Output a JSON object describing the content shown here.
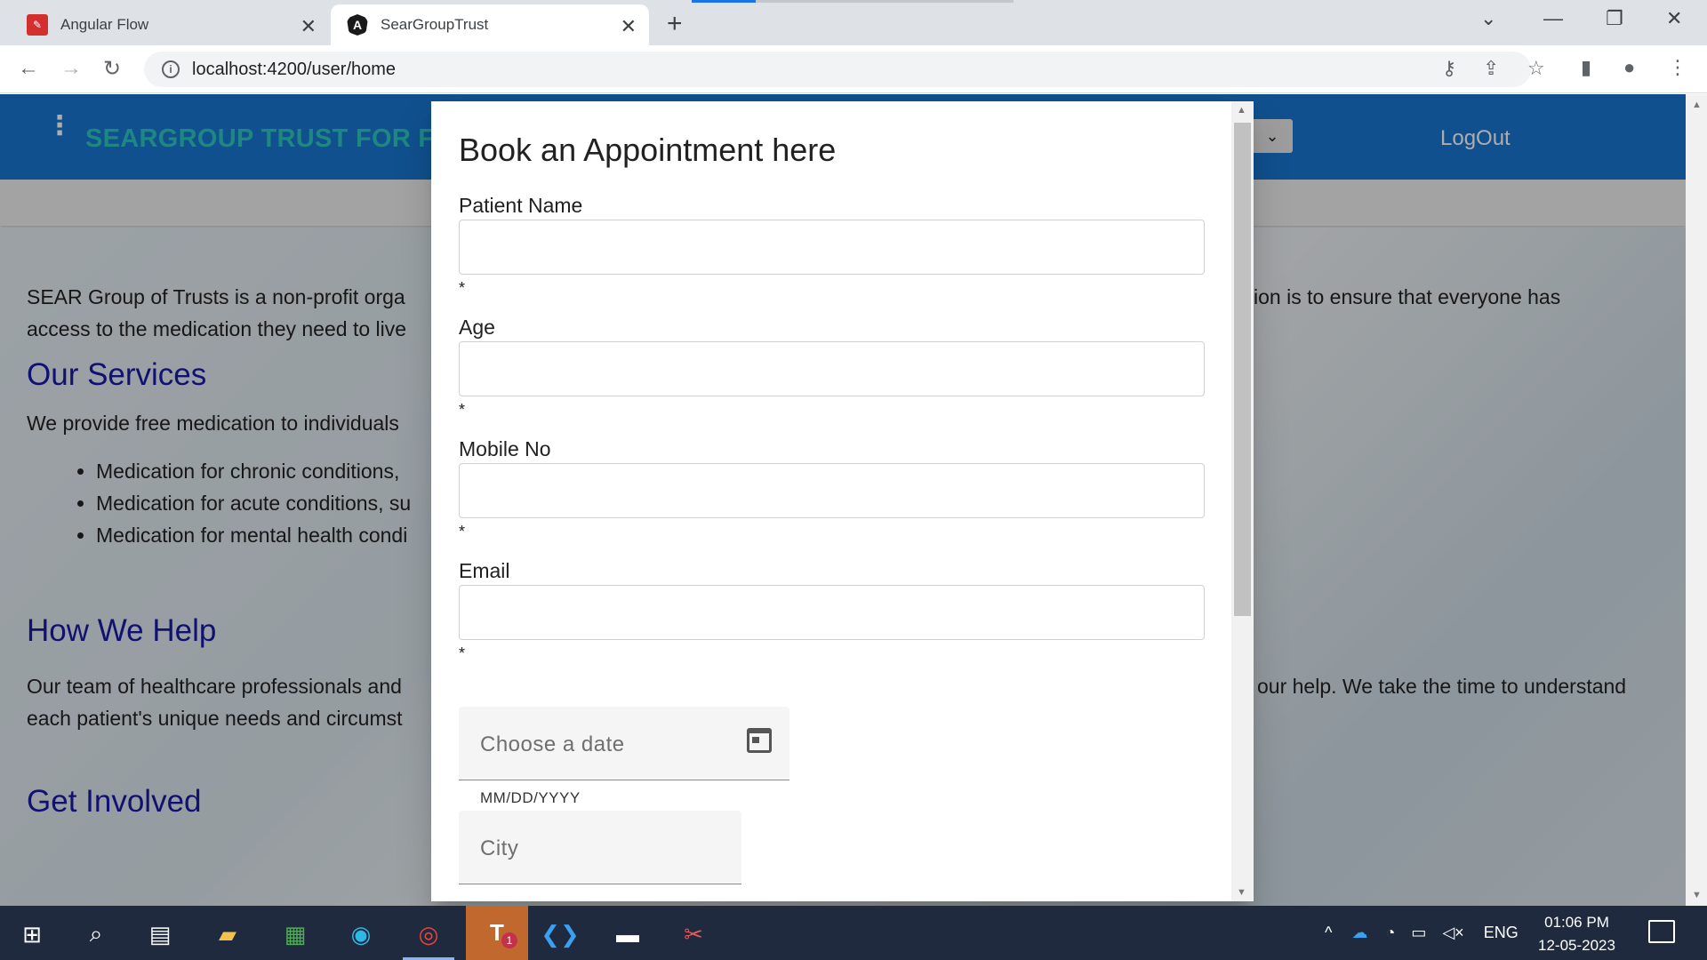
{
  "browser": {
    "tabs": [
      {
        "title": "Angular Flow",
        "icon": "angular-flow-icon",
        "active": false
      },
      {
        "title": "SearGroupTrust",
        "icon": "angular-icon",
        "active": true
      }
    ],
    "url": "localhost:4200/user/home"
  },
  "app": {
    "brand": "SEARGROUP TRUST FOR FR",
    "logout": "LogOut",
    "colors": {
      "nav": "#1976d2",
      "brand": "#2ec7c0",
      "heading": "#1a1aa8"
    }
  },
  "page": {
    "intro_left": "SEAR Group of Trusts is a non-profit orga",
    "intro_right": "ion is to ensure that everyone has",
    "intro_line2": "access to the medication they need to live",
    "services_heading": "Our Services",
    "services_text": "We provide free medication to individuals",
    "services_items": [
      "Medication for chronic conditions,",
      "Medication for acute conditions, su",
      "Medication for mental health condi"
    ],
    "help_heading": "How We Help",
    "help_left": "Our team of healthcare professionals and",
    "help_right": "our help. We take the time to understand",
    "help_line2": "each patient's unique needs and circumst",
    "involved_heading": "Get Involved"
  },
  "dialog": {
    "title": "Book an Appointment here",
    "fields": [
      {
        "label": "Patient Name",
        "value": "",
        "required_mark": "*"
      },
      {
        "label": "Age",
        "value": "",
        "required_mark": "*"
      },
      {
        "label": "Mobile No",
        "value": "",
        "required_mark": "*"
      },
      {
        "label": "Email",
        "value": "",
        "required_mark": "*"
      }
    ],
    "date": {
      "placeholder": "Choose a date",
      "hint": "MM/DD/YYYY"
    },
    "city": {
      "placeholder": "City"
    }
  },
  "taskbar": {
    "tray_language": "ENG",
    "time": "01:06 PM",
    "date": "12-05-2023",
    "teams_badge": "1"
  }
}
